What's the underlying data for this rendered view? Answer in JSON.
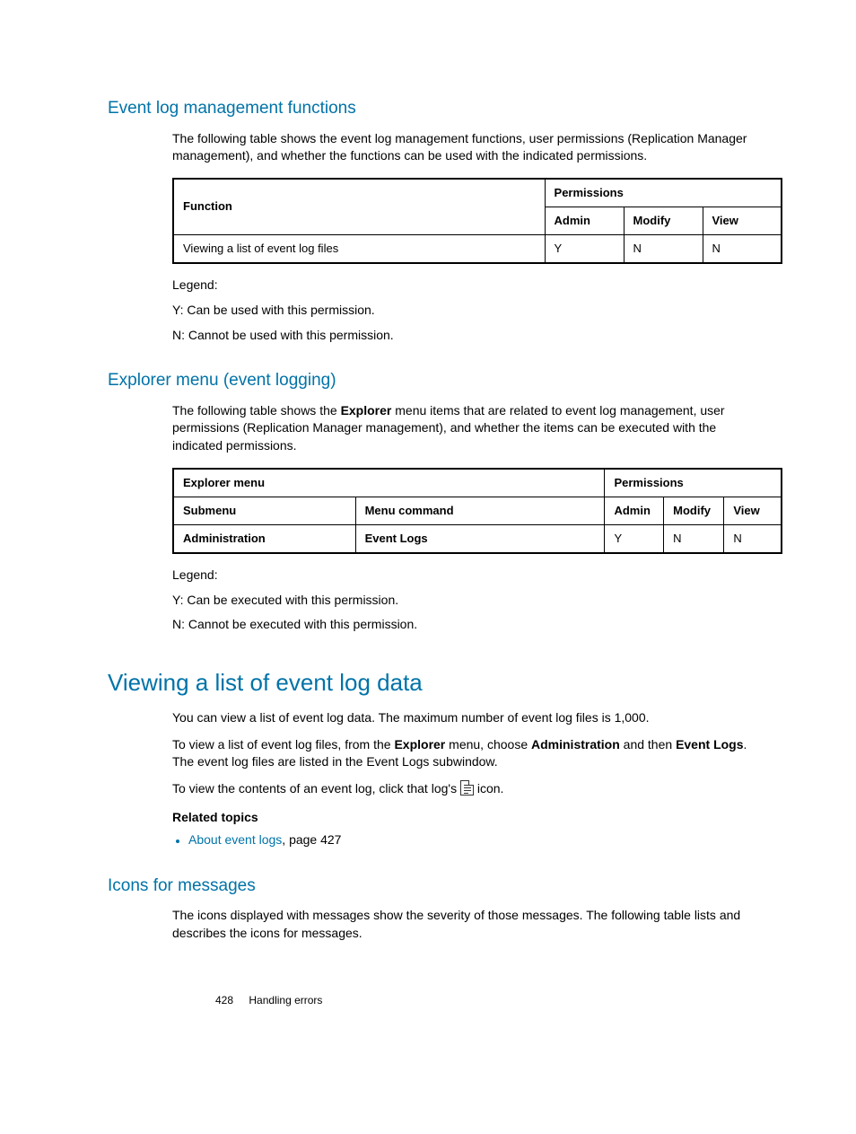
{
  "section1": {
    "heading": "Event log management functions",
    "intro": "The following table shows the event log management functions, user permissions (Replication Manager management), and whether the functions can be used with the indicated permissions.",
    "table": {
      "function_header": "Function",
      "perm_header": "Permissions",
      "admin": "Admin",
      "modify": "Modify",
      "view": "View",
      "row": {
        "function": "Viewing a list of event log files",
        "admin_v": "Y",
        "modify_v": "N",
        "view_v": "N"
      }
    },
    "legend": {
      "title": "Legend:",
      "y": "Y: Can be used with this permission.",
      "n": "N: Cannot be used with this permission."
    }
  },
  "section2": {
    "heading": "Explorer menu (event logging)",
    "intro_a": "The following table shows the ",
    "intro_bold": "Explorer",
    "intro_b": " menu items that are related to event log management, user permissions (Replication Manager management), and whether the items can be executed with the indicated permissions.",
    "table": {
      "exp_header": "Explorer menu",
      "perm_header": "Permissions",
      "submenu": "Submenu",
      "menucmd": "Menu command",
      "admin": "Admin",
      "modify": "Modify",
      "view": "View",
      "row": {
        "submenu_v": "Administration",
        "cmd_v": "Event Logs",
        "admin_v": "Y",
        "modify_v": "N",
        "view_v": "N"
      }
    },
    "legend": {
      "title": "Legend:",
      "y": "Y: Can be executed with this permission.",
      "n": "N: Cannot be executed with this permission."
    }
  },
  "section3": {
    "heading": "Viewing a list of event log data",
    "p1": "You can view a list of event log data. The maximum number of event log files is 1,000.",
    "p2_a": "To view a list of event log files, from the ",
    "p2_explorer": "Explorer",
    "p2_b": " menu, choose ",
    "p2_admin": "Administration",
    "p2_c": " and then ",
    "p2_logs": "Event Logs",
    "p2_d": ". The event log files are listed in the Event Logs subwindow.",
    "p3_a": "To view the contents of an event log, click that log's ",
    "p3_b": " icon.",
    "related_label": "Related topics",
    "related_link": "About event logs",
    "related_suffix": ", page 427"
  },
  "section4": {
    "heading": "Icons for messages",
    "p1": "The icons displayed with messages show the severity of those messages. The following table lists and describes the icons for messages."
  },
  "footer": {
    "page": "428",
    "chapter": "Handling errors"
  }
}
